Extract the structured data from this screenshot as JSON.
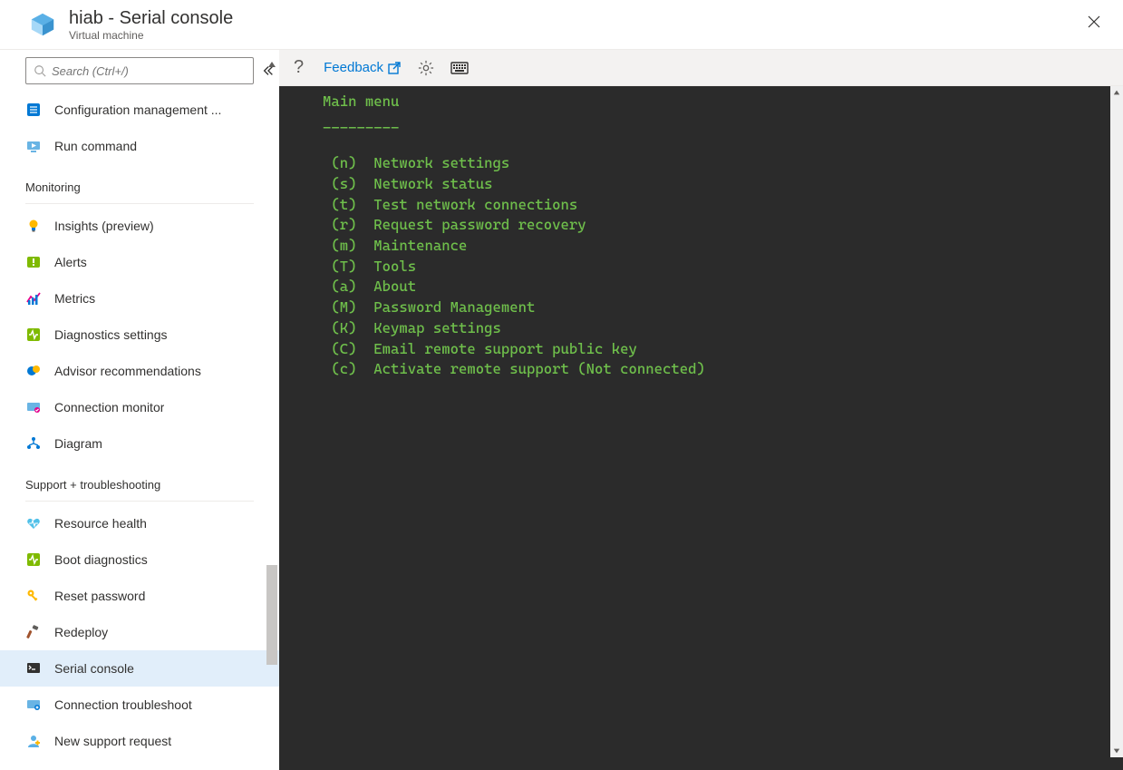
{
  "header": {
    "title": "hiab - Serial console",
    "subtitle": "Virtual machine"
  },
  "search": {
    "placeholder": "Search (Ctrl+/)"
  },
  "sidebar": {
    "top_items": [
      {
        "id": "config-mgmt",
        "label": "Configuration management ...",
        "icon": "list-blue"
      },
      {
        "id": "run-command",
        "label": "Run command",
        "icon": "run"
      }
    ],
    "monitoring": {
      "title": "Monitoring",
      "items": [
        {
          "id": "insights",
          "label": "Insights (preview)",
          "icon": "bulb"
        },
        {
          "id": "alerts",
          "label": "Alerts",
          "icon": "alert"
        },
        {
          "id": "metrics",
          "label": "Metrics",
          "icon": "metrics"
        },
        {
          "id": "diag",
          "label": "Diagnostics settings",
          "icon": "diag"
        },
        {
          "id": "advisor",
          "label": "Advisor recommendations",
          "icon": "advisor"
        },
        {
          "id": "connmon",
          "label": "Connection monitor",
          "icon": "connmon"
        },
        {
          "id": "diagram",
          "label": "Diagram",
          "icon": "diagram"
        }
      ]
    },
    "support": {
      "title": "Support + troubleshooting",
      "items": [
        {
          "id": "reshealth",
          "label": "Resource health",
          "icon": "heart"
        },
        {
          "id": "bootdiag",
          "label": "Boot diagnostics",
          "icon": "bootdiag"
        },
        {
          "id": "resetpw",
          "label": "Reset password",
          "icon": "key"
        },
        {
          "id": "redeploy",
          "label": "Redeploy",
          "icon": "hammer"
        },
        {
          "id": "serial",
          "label": "Serial console",
          "icon": "console",
          "selected": true
        },
        {
          "id": "conntrouble",
          "label": "Connection troubleshoot",
          "icon": "conntrouble"
        },
        {
          "id": "newsupport",
          "label": "New support request",
          "icon": "support"
        }
      ]
    }
  },
  "toolbar": {
    "feedback_label": "Feedback"
  },
  "terminal": {
    "header": "Main menu",
    "divider": "_________",
    "lines": [
      " (n)  Network settings",
      " (s)  Network status",
      " (t)  Test network connections",
      " (r)  Request password recovery",
      " (m)  Maintenance",
      " (T)  Tools",
      " (a)  About",
      " (M)  Password Management",
      " (K)  Keymap settings",
      " (C)  Email remote support public key",
      " (c)  Activate remote support (Not connected)"
    ]
  }
}
